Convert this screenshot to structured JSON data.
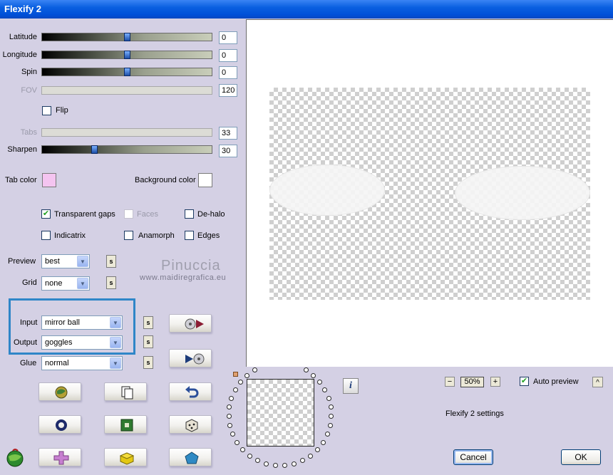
{
  "window": {
    "title": "Flexify 2"
  },
  "sliders": [
    {
      "label": "Latitude",
      "value": "0",
      "disabled": false,
      "position_fraction": 0.5
    },
    {
      "label": "Longitude",
      "value": "0",
      "disabled": false,
      "position_fraction": 0.5
    },
    {
      "label": "Spin",
      "value": "0",
      "disabled": false,
      "position_fraction": 0.5
    },
    {
      "label": "FOV",
      "value": "120",
      "disabled": true
    },
    {
      "label": "Tabs",
      "value": "33",
      "disabled": true
    },
    {
      "label": "Sharpen",
      "value": "30",
      "disabled": false,
      "position_fraction": 0.3
    }
  ],
  "flip": {
    "label": "Flip",
    "checked": false
  },
  "colors": {
    "tab_color_label": "Tab color",
    "tab_color": "#f4c4f0",
    "background_color_label": "Background color",
    "background_color": "#ffffff"
  },
  "options": {
    "transparent_gaps": {
      "label": "Transparent gaps",
      "checked": true
    },
    "faces": {
      "label": "Faces",
      "checked": false,
      "disabled": true
    },
    "de_halo": {
      "label": "De-halo",
      "checked": false
    },
    "indicatrix": {
      "label": "Indicatrix",
      "checked": false
    },
    "anamorph": {
      "label": "Anamorph",
      "checked": false
    },
    "edges": {
      "label": "Edges",
      "checked": false
    }
  },
  "selects": {
    "preview": {
      "label": "Preview",
      "value": "best"
    },
    "grid": {
      "label": "Grid",
      "value": "none"
    },
    "input": {
      "label": "Input",
      "value": "mirror ball"
    },
    "output": {
      "label": "Output",
      "value": "goggles"
    },
    "glue": {
      "label": "Glue",
      "value": "normal"
    }
  },
  "small_button_label": "s",
  "watermark": {
    "title": "Pinuccia",
    "url": "www.maidiregrafica.eu"
  },
  "zoom": {
    "value": "50%",
    "minus": "−",
    "plus": "+"
  },
  "auto_preview": {
    "label": "Auto preview",
    "checked": true,
    "caret": "^"
  },
  "settings_label": "Flexify 2 settings",
  "info_label": "i",
  "buttons": {
    "cancel": "Cancel",
    "ok": "OK"
  },
  "accent_colors": {
    "titlebar": "#0a5fe0",
    "highlight": "#2f86c8",
    "thumb": "#1d4fa8"
  }
}
